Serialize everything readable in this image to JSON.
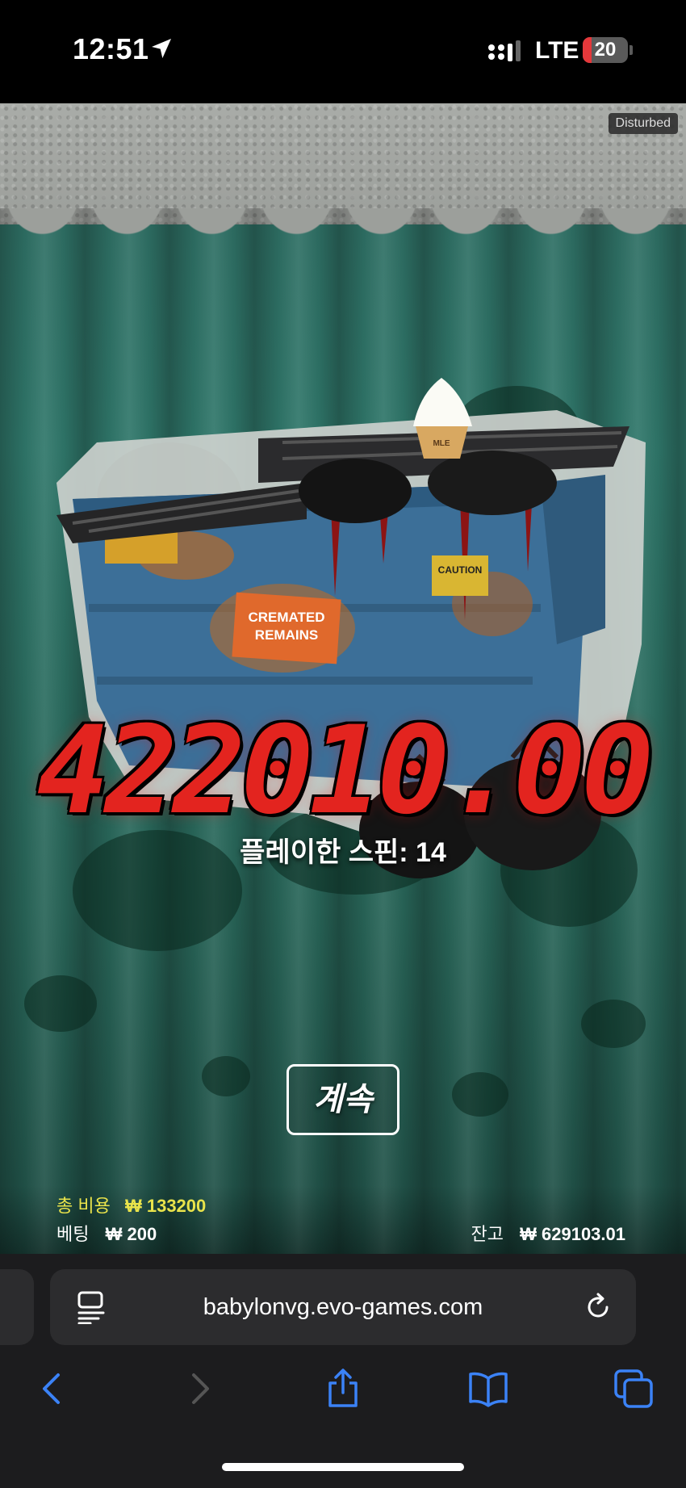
{
  "status_bar": {
    "time": "12:51",
    "network": "LTE",
    "battery_level": "20",
    "battery_fraction": 0.2
  },
  "game": {
    "badge": "Disturbed",
    "win_amount": "422010.00",
    "spins_played_text": "플레이한 스핀: 14",
    "continue_label": "계속",
    "total_cost_label": "총 비용",
    "total_cost_value": "₩ 133200",
    "bet_label": "베팅",
    "bet_value": "₩ 200",
    "balance_label": "잔고",
    "balance_value": "₩ 629103.01",
    "art_labels": {
      "crate": "CREMATED REMAINS",
      "caution": "CAUTION",
      "cone": "MLE"
    }
  },
  "browser": {
    "url": "babylonvg.evo-games.com",
    "icons": [
      "page-menu-icon",
      "reload-icon",
      "back-icon",
      "forward-icon",
      "share-icon",
      "bookmarks-icon",
      "tabs-icon"
    ]
  },
  "colors": {
    "payout_red": "#e3241f",
    "highlight_yellow": "#e9e34b",
    "ios_blue": "#3b82f6",
    "curtain_teal": "#2d6a60"
  }
}
